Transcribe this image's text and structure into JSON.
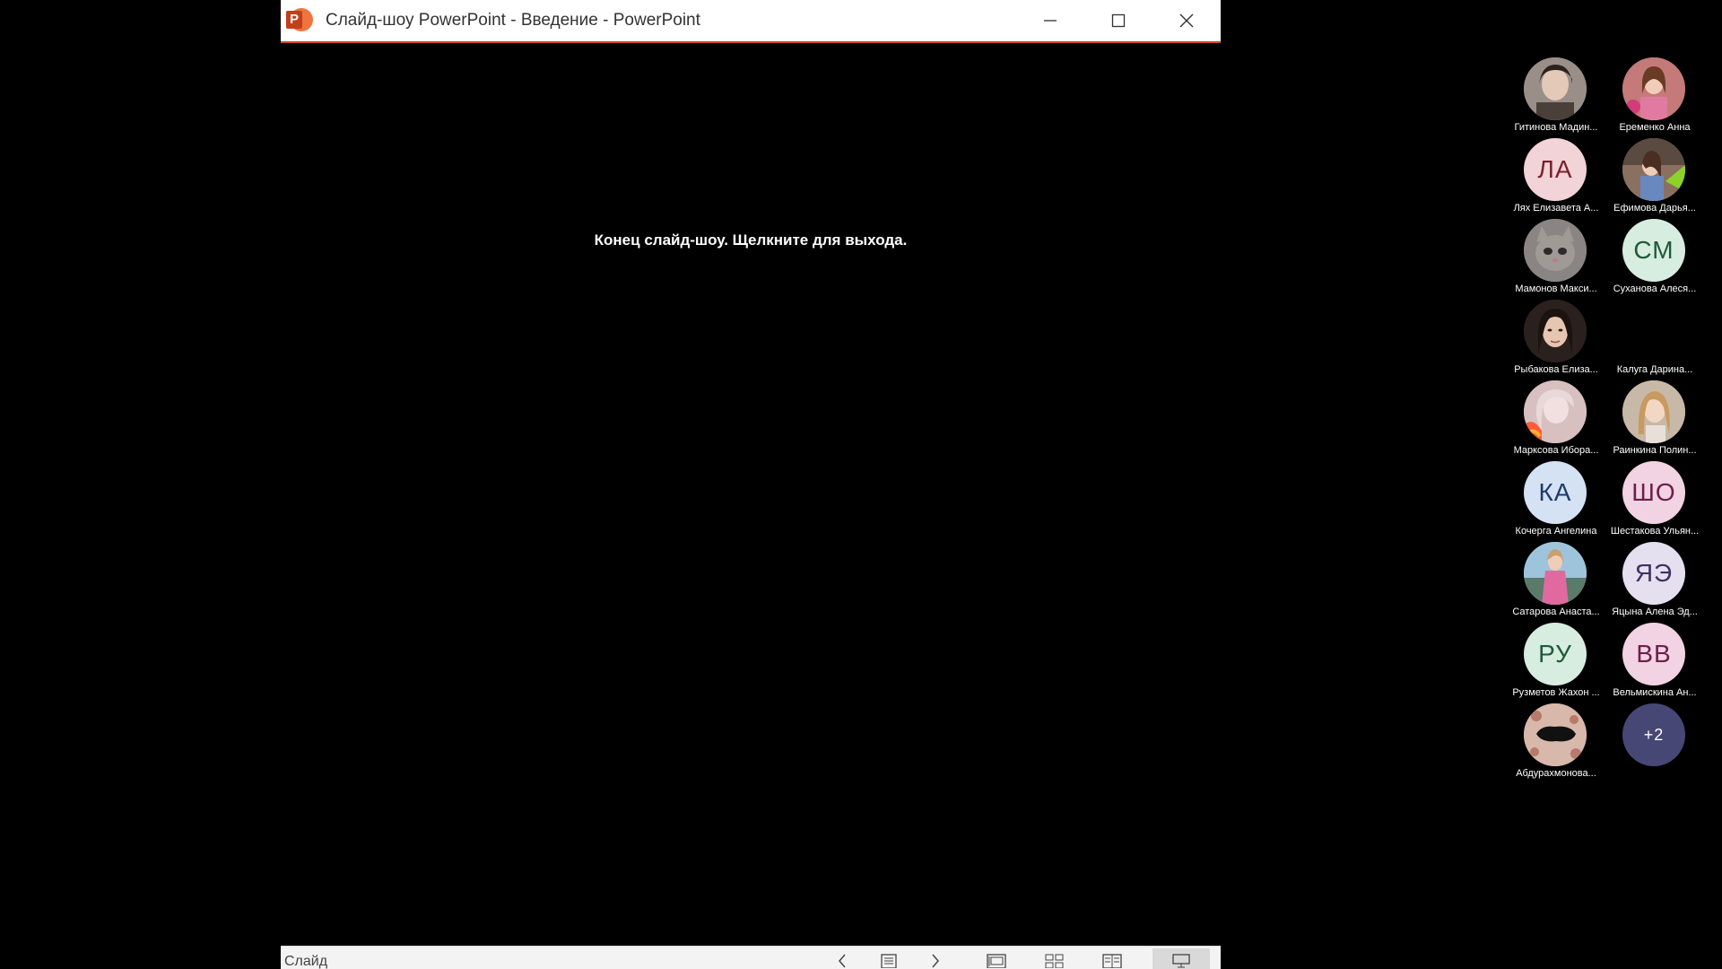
{
  "window": {
    "title": "Слайд-шоу PowerPoint  -  Введение - PowerPoint",
    "app_icon_letter": "P",
    "accent": "#d24726"
  },
  "slide": {
    "end_message": "Конец слайд-шоу. Щелкните для выхода."
  },
  "statusbar": {
    "label": "Слайд"
  },
  "participants": [
    {
      "name": "Гитинова Мадин...",
      "initials": "",
      "avatar": "photo",
      "bg": "#8a7f7a"
    },
    {
      "name": "Еременко Анна",
      "initials": "",
      "avatar": "photo",
      "bg": "#b86a6a"
    },
    {
      "name": "Лях Елизавета А...",
      "initials": "ЛА",
      "avatar": "initials",
      "bg": "#f2d3d7",
      "fg": "#7a1f2b"
    },
    {
      "name": "Ефимова Дарья...",
      "initials": "",
      "avatar": "photo",
      "bg": "#6b7f9a"
    },
    {
      "name": "Мамонов Макси...",
      "initials": "",
      "avatar": "photo",
      "bg": "#77716d"
    },
    {
      "name": "Суханова Алеся...",
      "initials": "СМ",
      "avatar": "initials",
      "bg": "#d7ede0",
      "fg": "#1e5a38"
    },
    {
      "name": "Рыбакова Елиза...",
      "initials": "",
      "avatar": "photo",
      "bg": "#3a2c2a"
    },
    {
      "name": "Калуга Дарина...",
      "initials": "",
      "avatar": "none",
      "bg": "#000000"
    },
    {
      "name": "Марксова Ибора...",
      "initials": "",
      "avatar": "photo",
      "bg": "#b98b8b"
    },
    {
      "name": "Раинкина Полин...",
      "initials": "",
      "avatar": "photo",
      "bg": "#a88e76"
    },
    {
      "name": "Кочерга Ангелина",
      "initials": "КА",
      "avatar": "initials",
      "bg": "#d4e2f3",
      "fg": "#1e3c6d"
    },
    {
      "name": "Шестакова Ульян...",
      "initials": "ШО",
      "avatar": "initials",
      "bg": "#f1d3e4",
      "fg": "#6d1e4a"
    },
    {
      "name": "Сатарова Анаста...",
      "initials": "",
      "avatar": "photo",
      "bg": "#6a9ab8"
    },
    {
      "name": "Яцына Алена Эд...",
      "initials": "ЯЭ",
      "avatar": "initials",
      "bg": "#e5e0f0",
      "fg": "#3e3060"
    },
    {
      "name": "Рузметов Жахон ...",
      "initials": "РУ",
      "avatar": "initials",
      "bg": "#d7ede0",
      "fg": "#1e5a38"
    },
    {
      "name": "Вельмискина Ан...",
      "initials": "ВВ",
      "avatar": "initials",
      "bg": "#f1d3e4",
      "fg": "#6d1e4a"
    },
    {
      "name": "Абдурахмонова...",
      "initials": "",
      "avatar": "photo",
      "bg": "#c9a89a"
    },
    {
      "name": "",
      "initials": "+2",
      "avatar": "more",
      "bg": "#464775",
      "fg": "#ffffff"
    }
  ]
}
